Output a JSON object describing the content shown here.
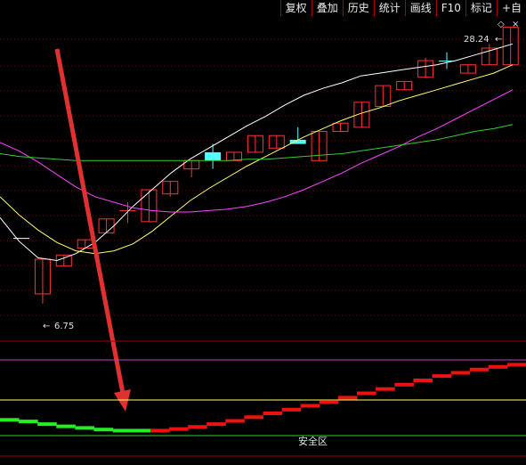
{
  "toolbar": {
    "items": [
      "复权",
      "叠加",
      "历史",
      "统计",
      "画线",
      "F10",
      "标记",
      "+自"
    ]
  },
  "chart_data": {
    "type": "candlestick",
    "price_high_label": "28.24",
    "price_low_label": "6.75",
    "candles": [
      {
        "o": 13.0,
        "c": 13.0,
        "h": 13.0,
        "l": 13.0,
        "color": "white"
      },
      {
        "o": 9.0,
        "c": 11.5,
        "h": 11.5,
        "l": 8.3,
        "color": "red"
      },
      {
        "o": 11.0,
        "c": 11.8,
        "h": 11.8,
        "l": 11.0,
        "color": "red"
      },
      {
        "o": 12.3,
        "c": 12.9,
        "h": 12.9,
        "l": 12.3,
        "color": "red"
      },
      {
        "o": 13.4,
        "c": 14.4,
        "h": 14.4,
        "l": 13.4,
        "color": "red"
      },
      {
        "o": 15.0,
        "c": 15.0,
        "h": 15.6,
        "l": 14.1,
        "color": "red"
      },
      {
        "o": 14.2,
        "c": 16.5,
        "h": 16.5,
        "l": 14.2,
        "color": "red"
      },
      {
        "o": 16.2,
        "c": 17.1,
        "h": 17.1,
        "l": 16.0,
        "color": "red"
      },
      {
        "o": 18.0,
        "c": 18.6,
        "h": 18.6,
        "l": 17.4,
        "color": "red"
      },
      {
        "o": 19.2,
        "c": 18.6,
        "h": 19.8,
        "l": 18.0,
        "color": "cyan"
      },
      {
        "o": 18.6,
        "c": 19.2,
        "h": 19.2,
        "l": 18.6,
        "color": "red"
      },
      {
        "o": 19.2,
        "c": 20.4,
        "h": 20.4,
        "l": 19.2,
        "color": "red"
      },
      {
        "o": 19.5,
        "c": 20.4,
        "h": 20.4,
        "l": 19.5,
        "color": "red"
      },
      {
        "o": 20.1,
        "c": 19.8,
        "h": 21.0,
        "l": 19.8,
        "color": "cyan"
      },
      {
        "o": 18.6,
        "c": 20.7,
        "h": 20.7,
        "l": 18.6,
        "color": "red"
      },
      {
        "o": 20.7,
        "c": 21.3,
        "h": 21.3,
        "l": 20.7,
        "color": "red"
      },
      {
        "o": 21.0,
        "c": 22.8,
        "h": 22.8,
        "l": 21.0,
        "color": "red"
      },
      {
        "o": 22.5,
        "c": 24.0,
        "h": 24.0,
        "l": 22.5,
        "color": "red"
      },
      {
        "o": 23.7,
        "c": 24.3,
        "h": 24.3,
        "l": 23.7,
        "color": "red"
      },
      {
        "o": 24.6,
        "c": 25.8,
        "h": 26.0,
        "l": 24.6,
        "color": "red"
      },
      {
        "o": 25.8,
        "c": 25.8,
        "h": 26.4,
        "l": 25.2,
        "color": "cyan"
      },
      {
        "o": 24.9,
        "c": 25.5,
        "h": 25.5,
        "l": 24.9,
        "color": "red"
      },
      {
        "o": 25.5,
        "c": 26.7,
        "h": 27.0,
        "l": 25.5,
        "color": "red"
      },
      {
        "o": 25.5,
        "c": 28.2,
        "h": 28.2,
        "l": 25.5,
        "color": "red"
      }
    ],
    "moving_averages": [
      {
        "color": "#ffffff",
        "values": [
          14.5,
          12.8,
          11.6,
          11.4,
          11.9,
          12.7,
          13.9,
          15.3,
          16.5,
          17.7,
          18.7,
          19.5,
          20.3,
          21.1,
          21.8,
          22.6,
          23.3,
          23.8,
          24.2,
          24.7,
          24.9,
          25.1,
          25.3,
          25.5,
          25.8,
          26.2,
          26.6,
          27.0
        ]
      },
      {
        "color": "#ffff66",
        "values": [
          16.0,
          14.7,
          13.6,
          12.7,
          12.1,
          11.9,
          12.1,
          12.6,
          13.5,
          14.6,
          15.7,
          16.6,
          17.4,
          18.2,
          18.9,
          19.6,
          20.3,
          20.9,
          21.5,
          22.0,
          22.4,
          22.9,
          23.3,
          23.7,
          24.1,
          24.5,
          24.9,
          25.5
        ]
      },
      {
        "color": "#ff44ff",
        "values": [
          19.9,
          19.3,
          18.5,
          17.6,
          16.7,
          16.0,
          15.6,
          15.2,
          15.0,
          14.9,
          14.9,
          15.0,
          15.1,
          15.3,
          15.6,
          16.0,
          16.5,
          17.1,
          17.7,
          18.4,
          19.0,
          19.6,
          20.3,
          20.9,
          21.6,
          22.3,
          23.0,
          23.7
        ]
      },
      {
        "color": "#33cc33",
        "values": [
          19.1,
          18.9,
          18.8,
          18.7,
          18.6,
          18.6,
          18.6,
          18.6,
          18.6,
          18.6,
          18.6,
          18.6,
          18.6,
          18.7,
          18.7,
          18.8,
          18.9,
          19.0,
          19.1,
          19.3,
          19.5,
          19.7,
          19.9,
          20.1,
          20.4,
          20.7,
          20.9,
          21.2
        ]
      }
    ],
    "indicator": {
      "label": "安全区",
      "values": [
        0.7,
        0.67,
        0.62,
        0.58,
        0.55,
        0.52,
        0.5,
        0.5,
        0.5,
        0.53,
        0.57,
        0.62,
        0.68,
        0.75,
        0.82,
        0.89,
        0.96,
        1.03,
        1.11,
        1.19,
        1.27,
        1.35,
        1.43,
        1.51,
        1.57,
        1.63,
        1.68,
        1.72
      ],
      "colors": [
        "green",
        "green",
        "green",
        "green",
        "green",
        "green",
        "green",
        "green",
        "red",
        "red",
        "red",
        "red",
        "red",
        "red",
        "red",
        "red",
        "red",
        "red",
        "red",
        "red",
        "red",
        "red",
        "red",
        "red",
        "red",
        "red",
        "red",
        "red"
      ]
    }
  }
}
